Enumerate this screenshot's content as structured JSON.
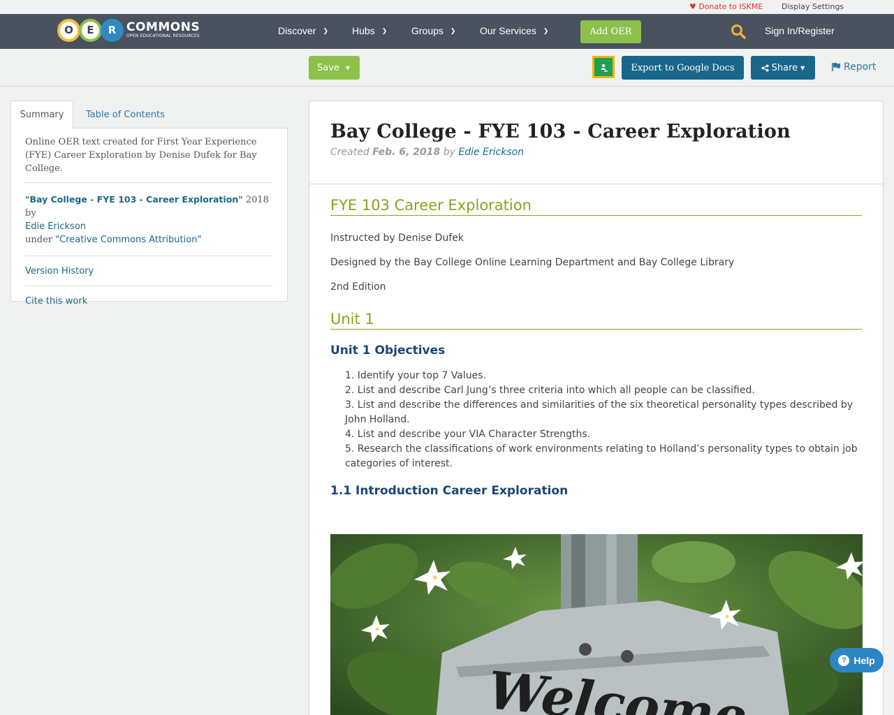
{
  "topstrip": {
    "donate_label": "Donate to ISKME",
    "display_settings_label": "Display Settings"
  },
  "logo": {
    "letters": [
      "O",
      "E",
      "R"
    ],
    "wordmark": "COMMONS",
    "tagline": "OPEN EDUCATIONAL RESOURCES"
  },
  "nav": {
    "items": [
      {
        "label": "Discover"
      },
      {
        "label": "Hubs"
      },
      {
        "label": "Groups"
      },
      {
        "label": "Our Services"
      }
    ],
    "add_oer_label": "Add OER",
    "signin_label": "Sign In/Register"
  },
  "toolbar": {
    "save_label": "Save",
    "export_label": "Export to Google Docs",
    "share_label": "Share",
    "report_label": "Report"
  },
  "sidebar": {
    "tabs": [
      {
        "label": "Summary",
        "active": true
      },
      {
        "label": "Table of Contents",
        "active": false
      }
    ],
    "description": "Online OER text created for First Year Experience (FYE) Career Exploration by Denise Dufek for Bay College.",
    "license": {
      "title": "\"Bay College - FYE 103 - Career Exploration\"",
      "year_by": " 2018 by",
      "author": "Edie Erickson",
      "under": "under ",
      "license_name": "\"Creative Commons Attribution\""
    },
    "version_history_label": "Version History",
    "cite_label": "Cite this work"
  },
  "main": {
    "title": "Bay College - FYE 103 - Career Exploration",
    "created_prefix": "Created ",
    "created_date": "Feb. 6, 2018",
    "by": " by ",
    "author": "Edie Erickson",
    "section1_heading": "FYE 103 Career Exploration",
    "instructed_by": "Instructed by Denise Dufek",
    "designed_by": "Designed by the Bay College Online Learning Department and Bay College Library",
    "edition": "2nd Edition",
    "unit_heading": "Unit 1",
    "objectives_heading": "Unit 1 Objectives",
    "objectives": [
      "1. Identify your top 7 Values.",
      "2. List and describe Carl Jung’s three criteria into which all people can be classified.",
      "3. List and describe the differences and similarities of the six theoretical personality types described by John Holland.",
      "4. List and describe your VIA Character Strengths.",
      "5. Research the classifications of work environments relating to Holland’s personality types to obtain job categories of interest."
    ],
    "intro_heading": "1.1 Introduction Career Exploration",
    "image_sign_text": "Welcome"
  },
  "help": {
    "label": "Help"
  },
  "colors": {
    "navbar": "#4a5260",
    "green": "#8cc04b",
    "blue_button": "#19678a",
    "link": "#19678a",
    "heading_green": "#7fa81a",
    "heading_blue": "#19467a"
  }
}
